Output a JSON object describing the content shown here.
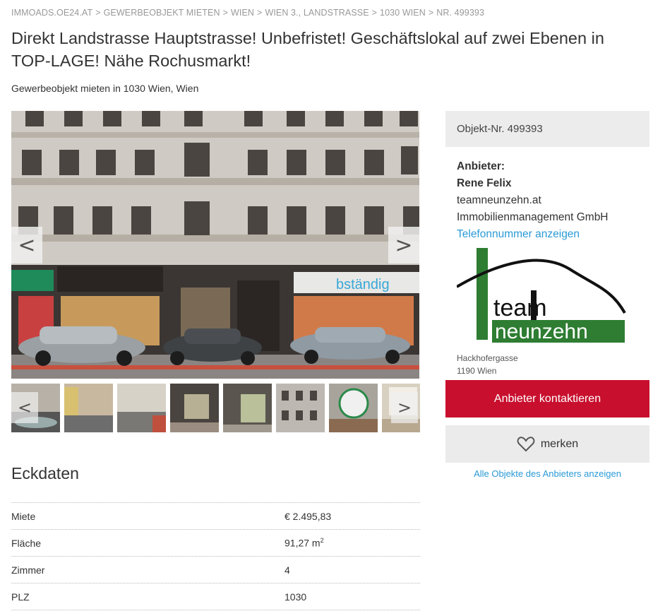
{
  "breadcrumb": [
    {
      "label": "IMMOADS.OE24.AT"
    },
    {
      "label": "GEWERBEOBJEKT MIETEN"
    },
    {
      "label": "WIEN"
    },
    {
      "label": "WIEN 3., LANDSTRASSE"
    },
    {
      "label": "1030 WIEN"
    },
    {
      "label": "NR. 499393"
    }
  ],
  "breadcrumb_separator": ">",
  "title": "Direkt Landstrasse Hauptstrasse! Unbefristet! Geschäftslokal auf zwei Ebenen in TOP-LAGE! Nähe Rochusmarkt!",
  "subtitle": "Gewerbeobjekt mieten in 1030 Wien, Wien",
  "gallery": {
    "prev_icon": "chevron-left-icon",
    "next_icon": "chevron-right-icon",
    "prev_glyph": "<",
    "next_glyph": ">",
    "shop_sign": "bständig",
    "thumbnail_count": 8
  },
  "eckdaten": {
    "title": "Eckdaten",
    "rows": [
      {
        "label": "Miete",
        "value": "€ 2.495,83"
      },
      {
        "label": "Fläche",
        "value": "91,27 m",
        "sup": "2"
      },
      {
        "label": "Zimmer",
        "value": "4"
      },
      {
        "label": "PLZ",
        "value": "1030"
      }
    ]
  },
  "sidebar": {
    "object_nr": "Objekt-Nr. 499393",
    "provider_heading": "Anbieter:",
    "provider_name": "Rene Felix",
    "provider_company_1": "teamneunzehn.at",
    "provider_company_2": "Immobilienmanagement GmbH",
    "phone_link": "Telefonnummer anzeigen",
    "logo_word_1": "team",
    "logo_word_2": "neunzehn",
    "address_line_1": "Hackhofergasse",
    "address_line_2": "1190 Wien",
    "contact_button": "Anbieter kontaktieren",
    "save_button": "merken",
    "all_objects_link": "Alle Objekte des Anbieters anzeigen"
  },
  "colors": {
    "primary_red": "#c8102e",
    "link_blue": "#2a9ad6",
    "logo_green": "#2e7d32"
  }
}
